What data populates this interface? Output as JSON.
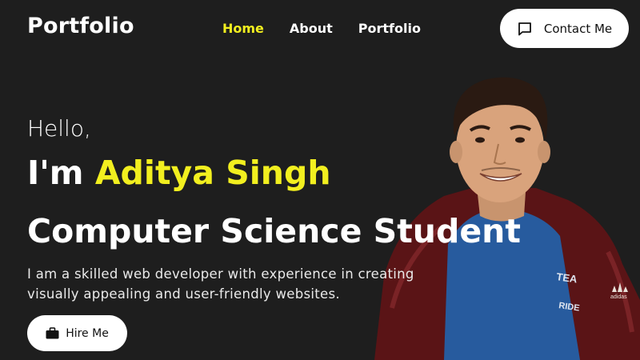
{
  "header": {
    "logo": "Portfolio",
    "nav": [
      {
        "label": "Home",
        "active": true
      },
      {
        "label": "About",
        "active": false
      },
      {
        "label": "Portfolio",
        "active": false
      }
    ],
    "contact_button": {
      "label": "Contact Me",
      "icon": "message-icon"
    }
  },
  "hero": {
    "greeting": "Hello,",
    "intro_prefix": "I'm",
    "name": "Aditya Singh",
    "role": "Computer Science Student",
    "description_line1": "I am a skilled web developer with experience in creating",
    "description_line2": "visually appealing and user-friendly websites.",
    "hire_button": {
      "label": "Hire Me",
      "icon": "briefcase-icon"
    },
    "photo_logo_text": "adidas"
  },
  "colors": {
    "background": "#1e1e1e",
    "accent": "#f2ef1f",
    "text": "#ffffff",
    "button_bg": "#ffffff"
  }
}
